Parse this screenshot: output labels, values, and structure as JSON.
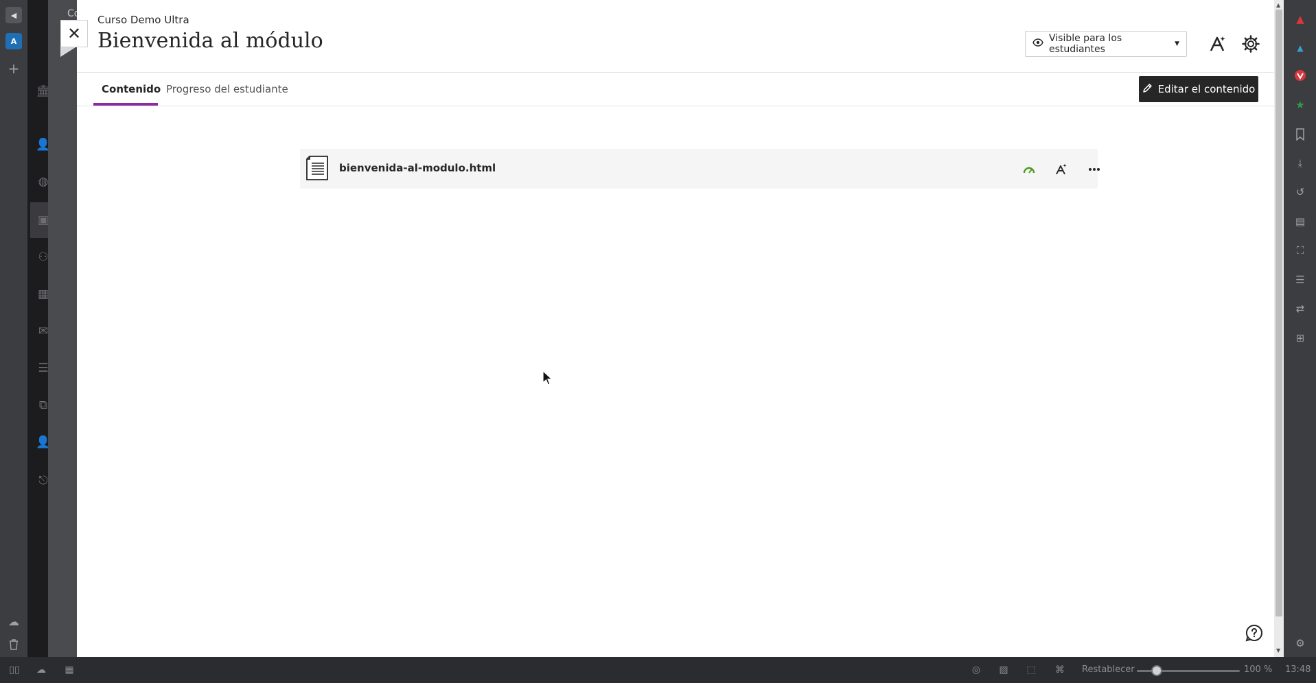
{
  "course_name": "Curso Demo Ultra",
  "page_title": "Bienvenida al módulo",
  "visibility": {
    "label": "Visible para los estudiantes"
  },
  "tabs": [
    {
      "label": "Contenido",
      "active": true
    },
    {
      "label": "Progreso del estudiante",
      "active": false
    }
  ],
  "edit_button": {
    "label": "Editar el contenido"
  },
  "content_items": [
    {
      "name": "bienvenida-al-modulo.html",
      "icon": "document-icon"
    }
  ],
  "status_bar": {
    "reset_label": "Restablecer",
    "zoom": "100 %",
    "time": "13:48"
  },
  "background_ghost_text": "Co",
  "colors": {
    "accent": "#8b2b9e",
    "primary_dark": "#262626",
    "progress_green": "#4a9a1e"
  }
}
